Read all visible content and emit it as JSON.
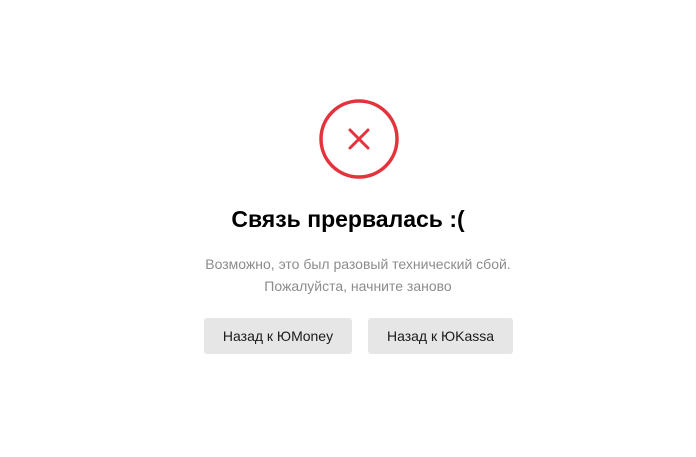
{
  "icon": {
    "name": "error-cross-icon",
    "color": "#e3343d"
  },
  "title": "Связь прервалась :(",
  "message": {
    "line1": "Возможно, это был разовый технический сбой.",
    "line2": "Пожалуйста, начните заново"
  },
  "buttons": {
    "back_yoomoney": "Назад к ЮMoney",
    "back_yookassa": "Назад к ЮKassa"
  },
  "colors": {
    "accent_error": "#e3343d",
    "button_bg": "#e6e6e6",
    "message_text": "#8c8c8c"
  }
}
